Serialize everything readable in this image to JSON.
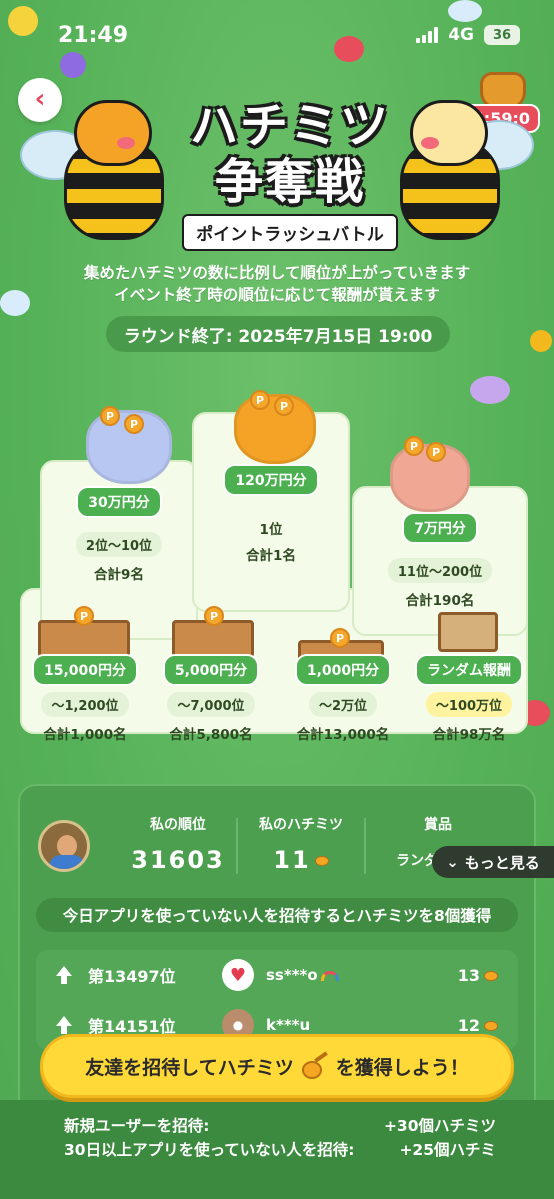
{
  "status": {
    "time": "21:49",
    "network": "4G",
    "battery": "36"
  },
  "header": {
    "timer": "05:59:0",
    "title_line1": "ハチミツ",
    "title_line2": "争奪戦",
    "subtitle": "ポイントラッシュバトル"
  },
  "description": {
    "line1": "集めたハチミツの数に比例して順位が上がっていきます",
    "line2": "イベント終了時の順位に応じて報酬が貰えます"
  },
  "round_end": "ラウンド終了: 2025年7月15日 19:00",
  "podium": {
    "first": {
      "reward": "120万円分",
      "rank": "1位",
      "total": "合計1名"
    },
    "second": {
      "reward": "30万円分",
      "rank": "2位〜10位",
      "total": "合計9名"
    },
    "third": {
      "reward": "7万円分",
      "rank": "11位〜200位",
      "total": "合計190名"
    },
    "tiers": [
      {
        "reward": "15,000円分",
        "rank": "〜1,200位",
        "total": "合計1,000名"
      },
      {
        "reward": "5,000円分",
        "rank": "〜7,000位",
        "total": "合計5,800名"
      },
      {
        "reward": "1,000円分",
        "rank": "〜2万位",
        "total": "合計13,000名"
      },
      {
        "reward": "ランダム報酬",
        "rank": "〜100万位",
        "total": "合計98万名"
      }
    ]
  },
  "my_stats": {
    "rank_label": "私の順位",
    "rank_value": "31603",
    "honey_label": "私のハチミツ",
    "honey_value": "11",
    "prize_label": "賞品",
    "prize_value": "ランダム報酬"
  },
  "more_button": "もっと見る",
  "invite_hint": "今日アプリを使っていない人を招待するとハチミツを8個獲得",
  "ranking": [
    {
      "rank": "第13497位",
      "user": "ss***o",
      "score": "13"
    },
    {
      "rank": "第14151位",
      "user": "k***u",
      "score": "12"
    }
  ],
  "cta": {
    "before": "友達を招待してハチミツ",
    "after": "を獲得しよう！"
  },
  "bonuses": [
    {
      "label": "新規ユーザーを招待:",
      "value": "+30個ハチミツ"
    },
    {
      "label": "30日以上アプリを使っていない人を招待:",
      "value": "+25個ハチミ"
    }
  ],
  "colors": {
    "background": "#5cb85c",
    "accent_yellow": "#ffd938",
    "timer_red": "#e84d5b",
    "reward_green": "#4caf50"
  }
}
